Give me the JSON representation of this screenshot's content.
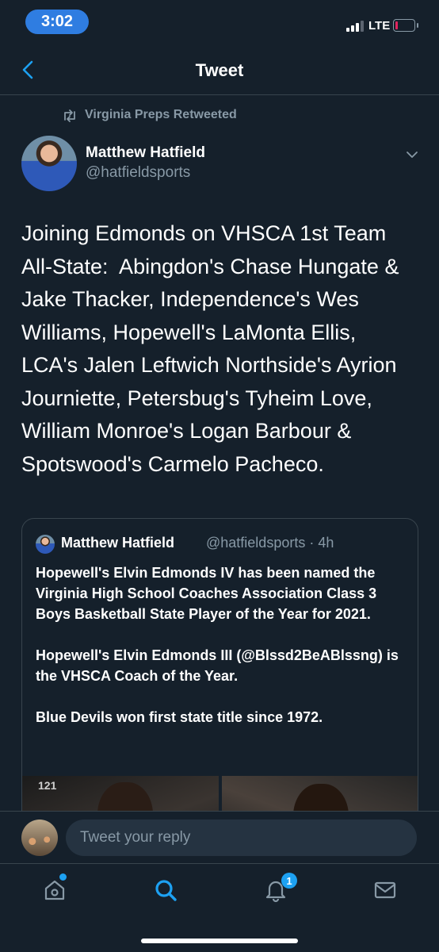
{
  "status_bar": {
    "time": "3:02",
    "network": "LTE"
  },
  "header": {
    "title": "Tweet"
  },
  "retweet": {
    "label": "Virginia Preps Retweeted"
  },
  "tweet": {
    "author_name": "Matthew Hatfield",
    "author_handle": "@hatfieldsports",
    "text": "Joining Edmonds on VHSCA 1st Team All-State:  Abingdon's Chase Hungate & Jake Thacker, Independence's Wes Williams, Hopewell's LaMonta Ellis, LCA's Jalen Leftwich Northside's Ayrion Journiette, Petersbug's Tyheim Love, William Monroe's Logan Barbour & Spotswood's Carmelo Pacheco."
  },
  "quoted_tweet": {
    "author_name": "Matthew Hatfield",
    "author_handle": "@hatfieldsports",
    "time": "· 4h",
    "text": "Hopewell's Elvin Edmonds IV has been named the Virginia High School Coaches Association Class 3 Boys Basketball State Player of the Year for 2021.\n\nHopewell's Elvin Edmonds III (@Blssd2BeABlssng) is the VHSCA Coach of the Year.\n\nBlue Devils won first state title since 1972.",
    "image_jersey_number": "121"
  },
  "reply": {
    "placeholder": "Tweet your reply"
  },
  "nav": {
    "notifications_count": "1"
  },
  "colors": {
    "background": "#15202b",
    "accent": "#1da1f2",
    "secondary_text": "#8899a6",
    "divider": "#38444d"
  },
  "icons": [
    "back-chevron-icon",
    "retweet-icon",
    "chevron-down-icon",
    "home-icon",
    "search-icon",
    "bell-icon",
    "mail-icon"
  ]
}
